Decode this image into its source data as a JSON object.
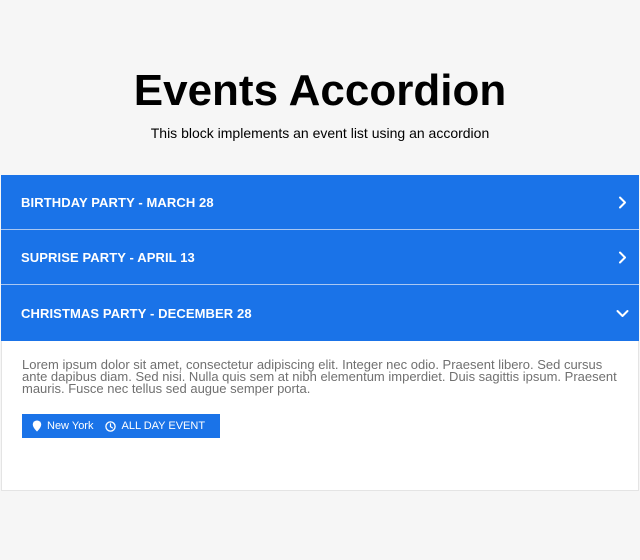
{
  "header": {
    "title": "Events Accordion",
    "subtitle": "This block implements an event list using an accordion"
  },
  "accordion": {
    "items": [
      {
        "title": "BIRTHDAY PARTY - MARCH 28",
        "expanded": false
      },
      {
        "title": "SUPRISE PARTY - APRIL 13",
        "expanded": false
      },
      {
        "title": "CHRISTMAS PARTY - DECEMBER 28",
        "expanded": true,
        "description": "Lorem ipsum dolor sit amet, consectetur adipiscing elit. Integer nec odio. Praesent libero. Sed cursus ante dapibus diam. Sed nisi. Nulla quis sem at nibh elementum imperdiet. Duis sagittis ipsum. Praesent mauris. Fusce nec tellus sed augue semper porta.",
        "location": "New York",
        "time": "ALL DAY EVENT"
      }
    ]
  },
  "colors": {
    "accent": "#1a73e8",
    "background": "#f6f6f6",
    "body_text": "#707070"
  },
  "icons": {
    "collapsed": "chevron-right-icon",
    "expanded": "chevron-down-icon",
    "location": "map-pin-icon",
    "time": "clock-icon"
  }
}
